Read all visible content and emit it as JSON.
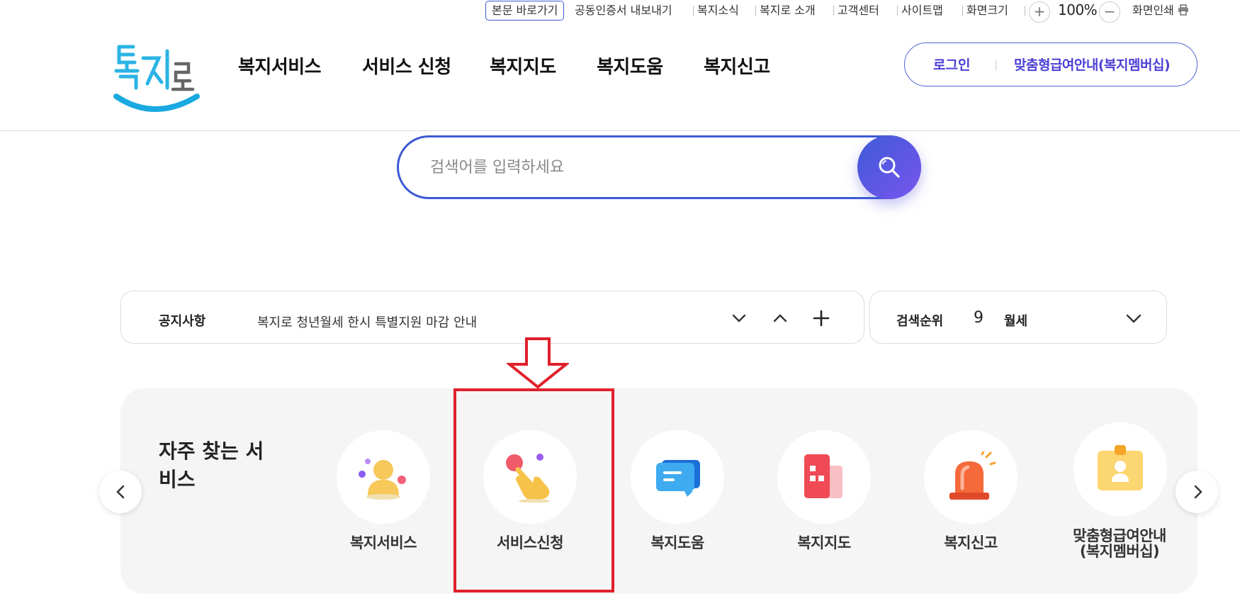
{
  "utility": {
    "skip_link": "본문 바로가기",
    "cert_export": "공동인증서 내보내기",
    "news": "복지소식",
    "about": "복지로 소개",
    "customer": "고객센터",
    "sitemap": "사이트맵",
    "font_size": "화면크기",
    "zoom_in": "+",
    "zoom_level": "100%",
    "zoom_out": "−",
    "print": "화면인쇄"
  },
  "header": {
    "logo_text": "복지로",
    "nav": [
      "복지서비스",
      "서비스 신청",
      "복지지도",
      "복지도움",
      "복지신고"
    ],
    "login": "로그인",
    "membership": "맞춤형급여안내(복지멤버십)"
  },
  "search": {
    "placeholder": "검색어를 입력하세요"
  },
  "notice": {
    "label": "공지사항",
    "text": "복지로 청년월세 한시 특별지원 마감 안내"
  },
  "ranking": {
    "label": "검색순위",
    "number": "9",
    "keyword": "월세"
  },
  "frequent": {
    "title": "자주 찾는 서비스",
    "items": [
      {
        "label": "복지서비스",
        "icon": "person-icon"
      },
      {
        "label": "서비스신청",
        "icon": "hand-tap-icon"
      },
      {
        "label": "복지도움",
        "icon": "chat-bubble-icon"
      },
      {
        "label": "복지지도",
        "icon": "map-building-icon"
      },
      {
        "label": "복지신고",
        "icon": "siren-icon"
      },
      {
        "label": "맞춤형급여안내\n(복지멤버십)",
        "label_line1": "맞춤형급여안내",
        "label_line2": "(복지멤버십)",
        "icon": "id-card-icon"
      }
    ]
  },
  "colors": {
    "accent": "#3d5bd6",
    "accent_purple": "#4a3fd6",
    "annotation_red": "#e0202a",
    "panel_bg": "#f5f5f5"
  }
}
